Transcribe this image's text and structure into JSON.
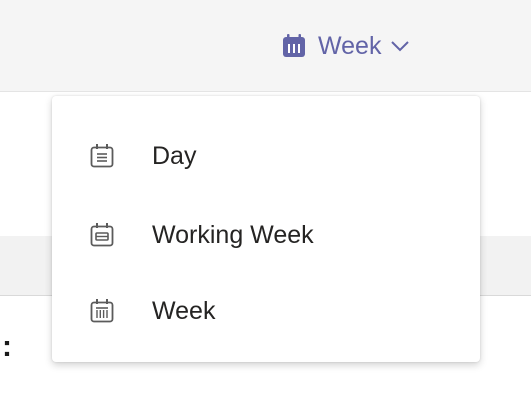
{
  "header": {
    "view_selector": {
      "label": "Week",
      "icon": "calendar-week-icon",
      "chevron": "chevron-down-icon",
      "accent_color": "#6264a7"
    }
  },
  "menu": {
    "items": [
      {
        "label": "Day",
        "icon": "calendar-day-icon"
      },
      {
        "label": "Working Week",
        "icon": "calendar-work-week-icon"
      },
      {
        "label": "Week",
        "icon": "calendar-week-icon"
      }
    ]
  },
  "fragments": {
    "colon": ":"
  }
}
